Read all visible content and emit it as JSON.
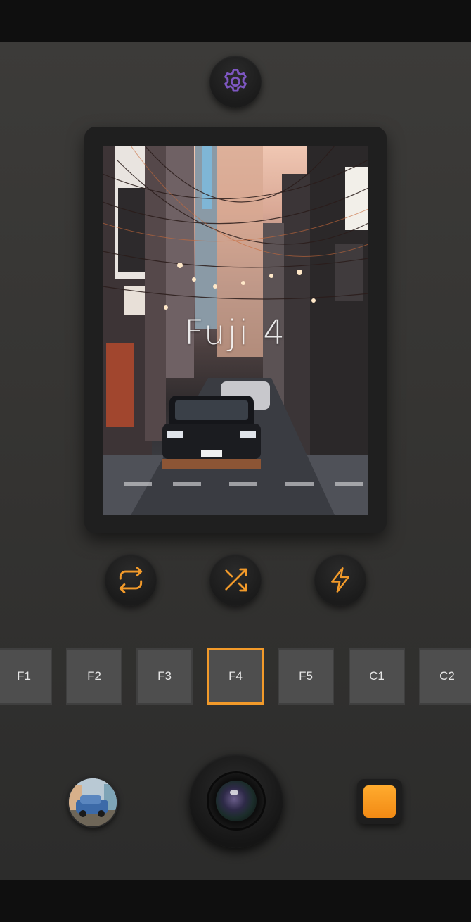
{
  "preview": {
    "filter_name": "Fuji 4"
  },
  "filters": [
    {
      "label": "F1",
      "selected": false
    },
    {
      "label": "F2",
      "selected": false
    },
    {
      "label": "F3",
      "selected": false
    },
    {
      "label": "F4",
      "selected": true
    },
    {
      "label": "F5",
      "selected": false
    },
    {
      "label": "C1",
      "selected": false
    },
    {
      "label": "C2",
      "selected": false
    }
  ],
  "icons": {
    "settings": "gear-icon",
    "repeat": "repeat-icon",
    "shuffle": "shuffle-icon",
    "flash": "flash-icon",
    "shutter": "camera-lens-icon",
    "gallery": "gallery-thumbnail",
    "stop": "stop-icon"
  },
  "colors": {
    "accent_orange": "#F29A2A",
    "gear_purple": "#7E57C2",
    "chip_bg": "#4E4E4E",
    "background": "#3A3937"
  }
}
